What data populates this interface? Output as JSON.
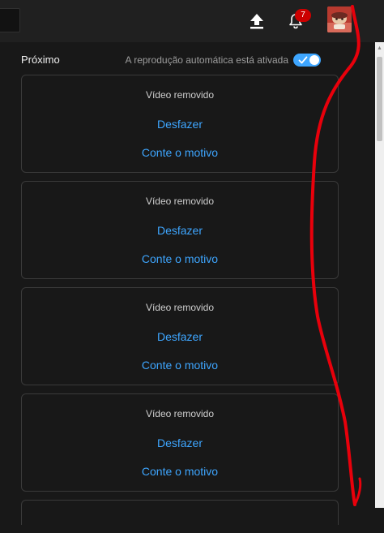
{
  "header": {
    "notification_count": "7",
    "icons": {
      "upload": "upload-icon",
      "notifications": "bell-icon",
      "avatar": "avatar-image"
    }
  },
  "up_next": {
    "title": "Próximo",
    "autoplay_label": "A reprodução automática está ativada",
    "autoplay_enabled": true
  },
  "removed_cards": [
    {
      "message": "Vídeo removido",
      "undo": "Desfazer",
      "reason": "Conte o motivo"
    },
    {
      "message": "Vídeo removido",
      "undo": "Desfazer",
      "reason": "Conte o motivo"
    },
    {
      "message": "Vídeo removido",
      "undo": "Desfazer",
      "reason": "Conte o motivo"
    },
    {
      "message": "Vídeo removido",
      "undo": "Desfazer",
      "reason": "Conte o motivo"
    }
  ],
  "colors": {
    "background": "#181818",
    "topbar": "#202020",
    "accent": "#3ea6ff",
    "badge": "#cc0000",
    "annotation_stroke": "#e8000b"
  }
}
